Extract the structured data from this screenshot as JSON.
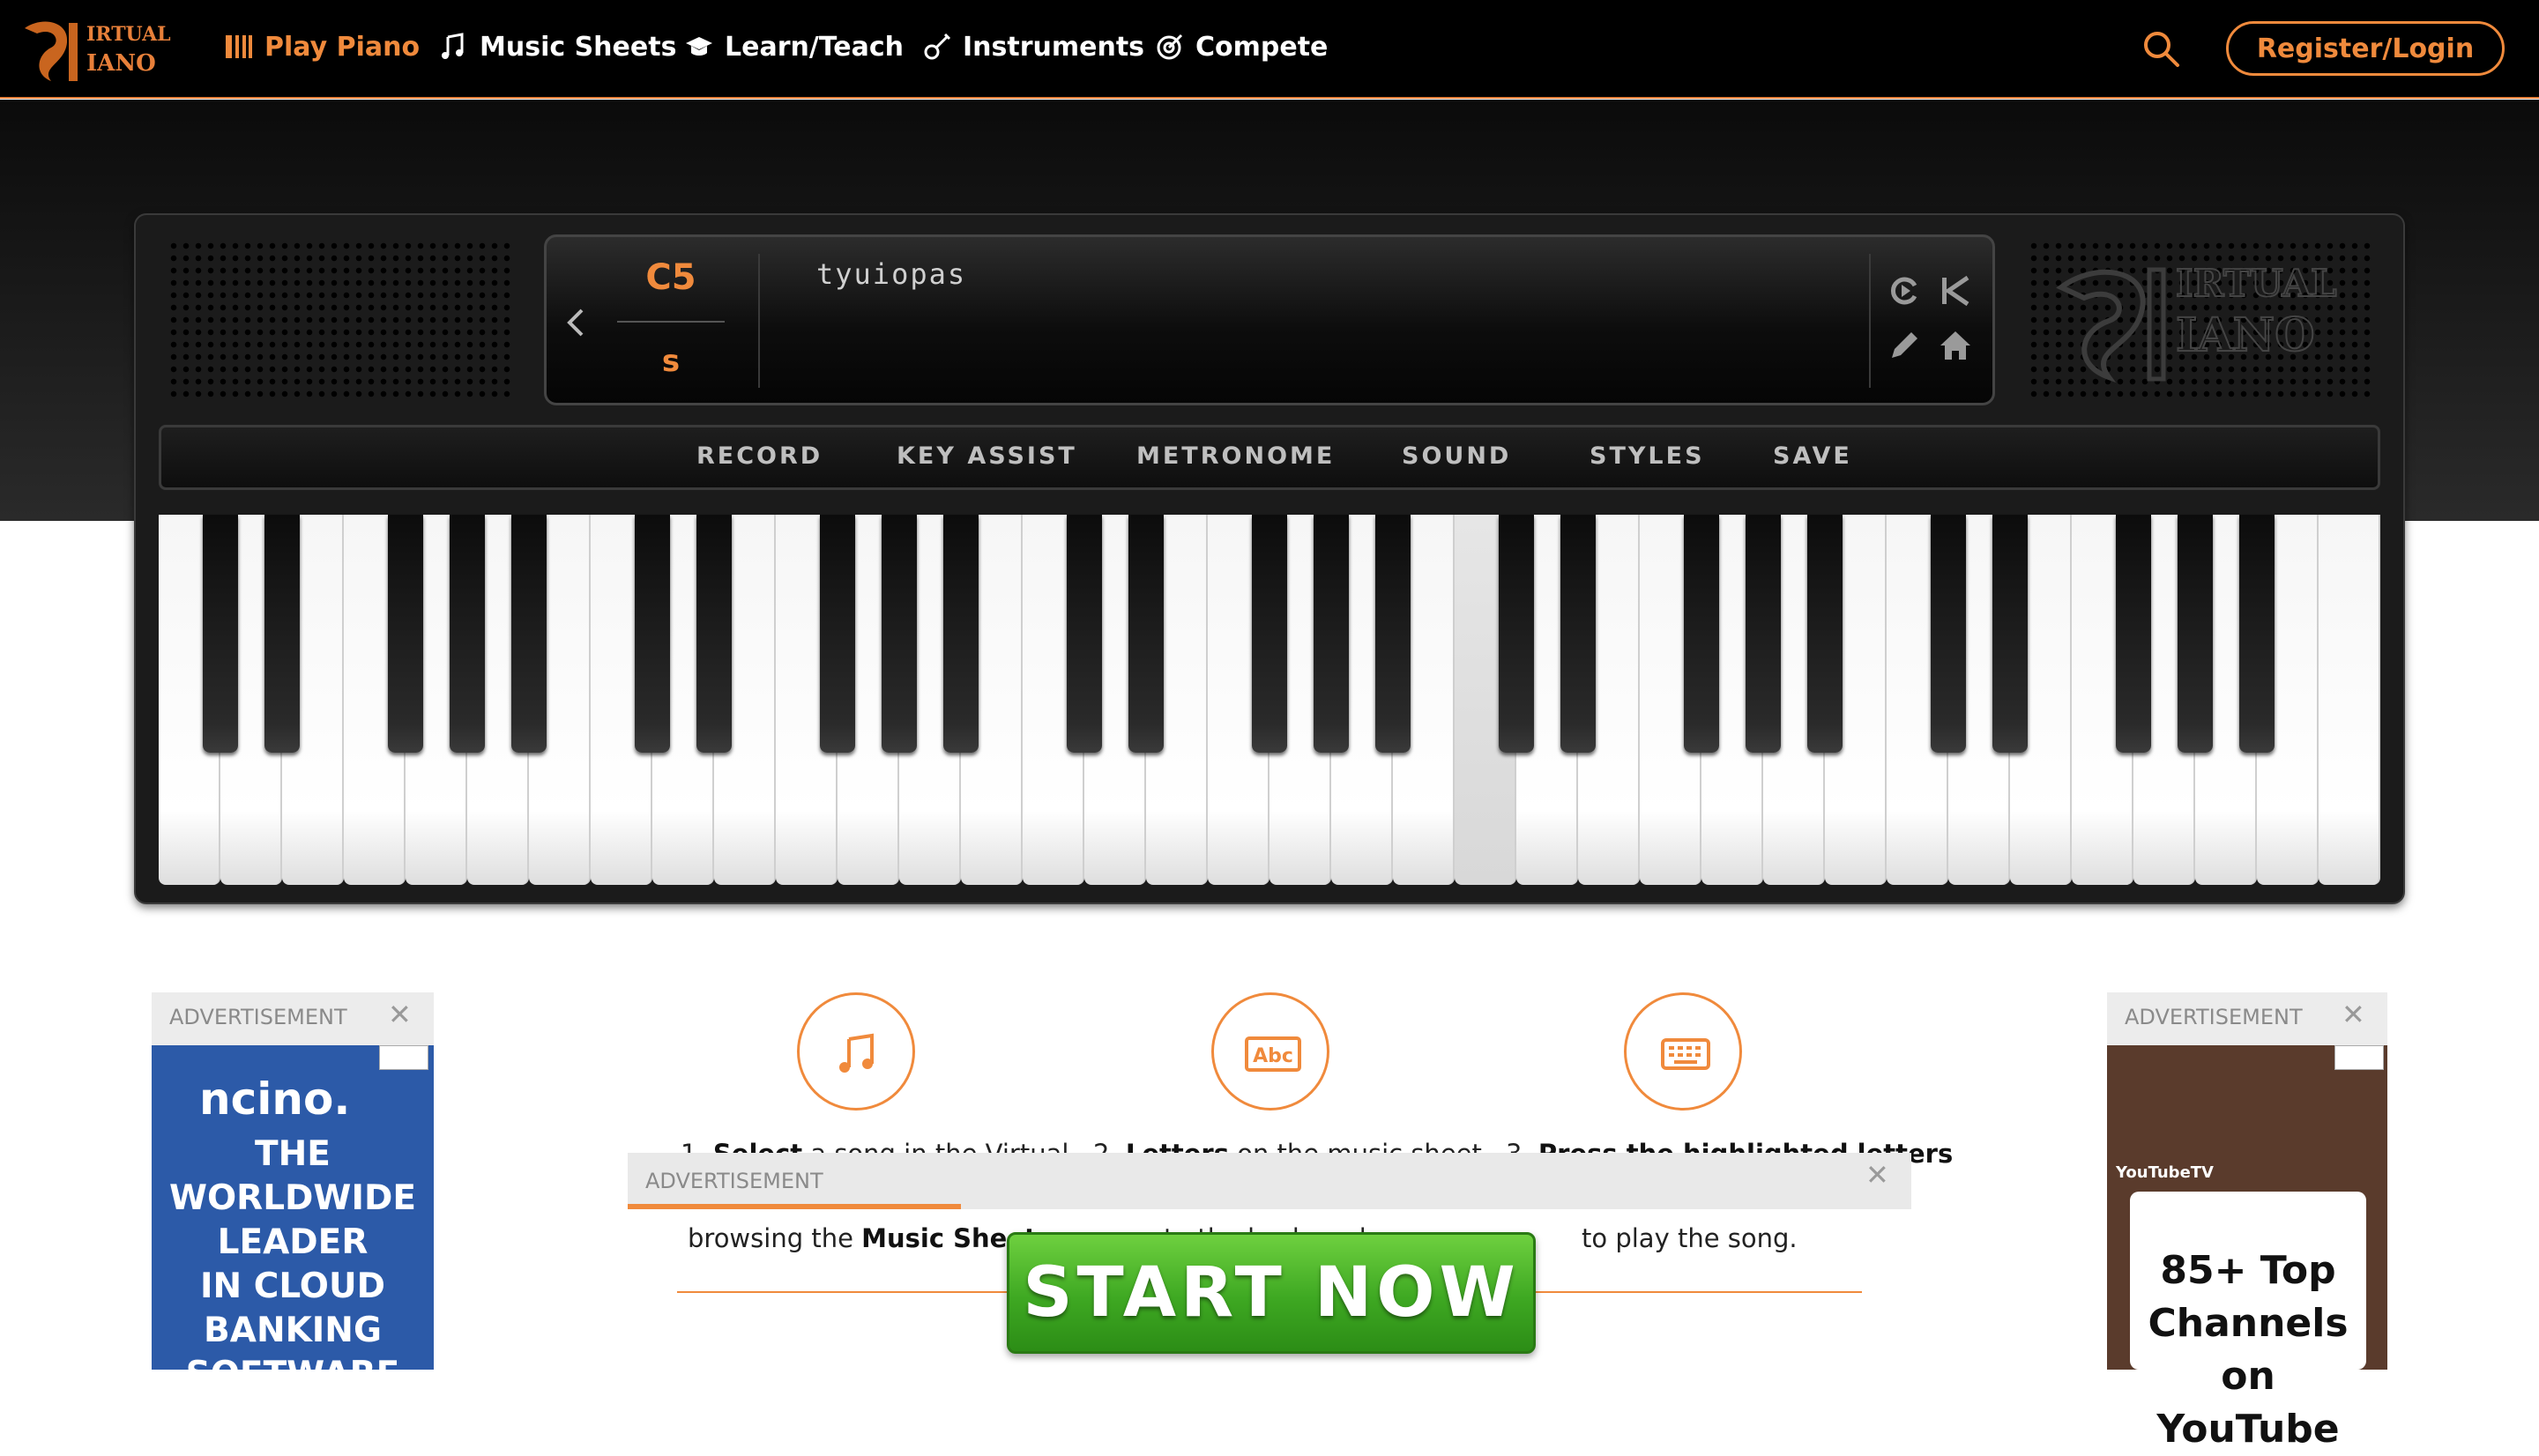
{
  "header": {
    "logo_text": "VIRTUAL PIANO",
    "nav": [
      {
        "label": "Play Piano",
        "icon": "piano-keys-icon",
        "active": true
      },
      {
        "label": "Music Sheets",
        "icon": "music-notes-icon",
        "active": false
      },
      {
        "label": "Learn/Teach",
        "icon": "graduation-cap-icon",
        "active": false
      },
      {
        "label": "Instruments",
        "icon": "guitar-icon",
        "active": false
      },
      {
        "label": "Compete",
        "icon": "target-icon",
        "active": false
      }
    ],
    "search_icon": "search-icon",
    "login_label": "Register/Login",
    "accent_color": "#f08a3c"
  },
  "piano": {
    "note_name": "C5",
    "note_key": "s",
    "typed_keys": "tyuiopas",
    "watermark": "VIRTUAL PIANO",
    "toolbar": [
      "RECORD",
      "KEY ASSIST",
      "METRONOME",
      "SOUND",
      "STYLES",
      "SAVE"
    ],
    "display_icons": [
      "replay-icon",
      "skip-back-icon",
      "pencil-icon",
      "home-icon"
    ],
    "pressed_white_key_index": 21
  },
  "ads": {
    "label": "ADVERTISEMENT",
    "left": {
      "brand": "ncino.",
      "lines": [
        "THE",
        "WORLDWIDE",
        "LEADER",
        "IN CLOUD",
        "BANKING",
        "SOFTWARE"
      ]
    },
    "right": {
      "tag": "YouTubeTV",
      "lines": [
        "85+ Top",
        "Channels",
        "on YouTube"
      ]
    },
    "bottom": {
      "button": "START NOW"
    }
  },
  "steps": [
    {
      "icon": "music-notes-icon",
      "number": "1.",
      "bold": "Select",
      "text": "a song in the Virtual",
      "line2_prefix": "browsing the ",
      "line2_bold": "Music Sheets",
      "line2_suffix": ""
    },
    {
      "icon": "abc-icon",
      "number": "2.",
      "bold": "Letters",
      "text": "on the music sheet",
      "line2_prefix": "",
      "line2_bold": "",
      "line2_suffix": "to the keyboard"
    },
    {
      "icon": "keyboard-icon",
      "number": "3.",
      "bold": "Press the highlighted letters",
      "text": "",
      "line2_prefix": "",
      "line2_bold": "",
      "line2_suffix": "to play the song."
    }
  ]
}
